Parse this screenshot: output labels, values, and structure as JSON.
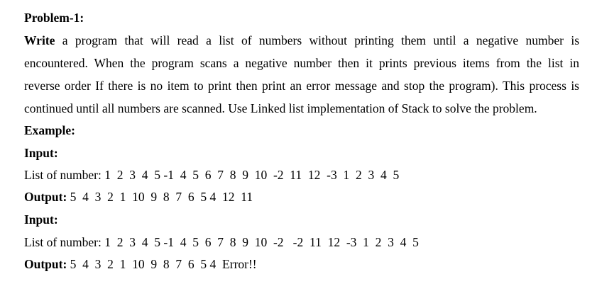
{
  "heading": "Problem-1:",
  "paragraph": {
    "lead": "Write",
    "line1": "a program that will read a list of numbers without printing them until a negative number is",
    "line2": "encountered. When the program scans a negative number then it prints previous items from the list in",
    "line3": "reverse order If there is no item to print then print an error message and stop the program). This process is",
    "line4": "continued until all numbers are scanned. Use Linked list implementation of Stack to solve the problem."
  },
  "example_label": "Example:",
  "examples": [
    {
      "input_label": "Input:",
      "list_text": "List of number: 1  2  3  4  5 -1  4  5  6  7  8  9  10  -2  11  12  -3  1  2  3  4  5",
      "output_label": "Output:",
      "output_value": " 5  4  3  2  1  10  9  8  7  6  5 4  12  11"
    },
    {
      "input_label": "Input:",
      "list_text": "List of number: 1  2  3  4  5 -1  4  5  6  7  8  9  10  -2   -2  11  12  -3  1  2  3  4  5",
      "output_label": "Output:",
      "output_value": " 5  4  3  2  1  10  9  8  7  6  5 4  Error!!"
    }
  ]
}
